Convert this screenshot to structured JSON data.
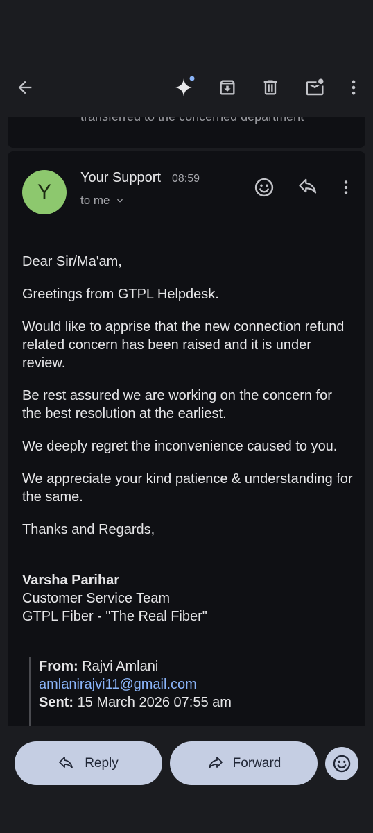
{
  "toolbar": {
    "icons": [
      "back-arrow-icon",
      "sparkle-icon",
      "archive-icon",
      "trash-icon",
      "mark-unread-icon",
      "more-vert-icon"
    ]
  },
  "previous_message": {
    "snippet": "transferred to the concerned department"
  },
  "message": {
    "avatar_letter": "Y",
    "avatar_color": "#8dc86e",
    "sender": "Your Support",
    "time": "08:59",
    "to": "to me",
    "body": [
      "Dear Sir/Ma'am,",
      "Greetings from GTPL Helpdesk.",
      "Would like to apprise that the new connection refund related concern has been raised and it is under review.",
      "Be rest assured we are working on the concern for the best resolution at the earliest.",
      "We deeply regret the inconvenience caused to you.",
      "We appreciate your kind patience & understanding for the same.",
      "Thanks and Regards,"
    ],
    "signature": {
      "name": "Varsha Parihar",
      "team": "Customer Service Team",
      "company": "GTPL Fiber - \"The Real Fiber\""
    },
    "quoted": {
      "from_label": "From:",
      "from_name": "Rajvi Amlani",
      "from_email": "amlanirajvi11@gmail.com",
      "sent_label": "Sent:",
      "sent_value": "15 March 2026 07:55 am"
    }
  },
  "actions": {
    "reply_label": "Reply",
    "forward_label": "Forward"
  },
  "colors": {
    "background": "#1b1c20",
    "card": "#0f1014",
    "pill": "#c5cee3",
    "link": "#8ab4f8"
  }
}
